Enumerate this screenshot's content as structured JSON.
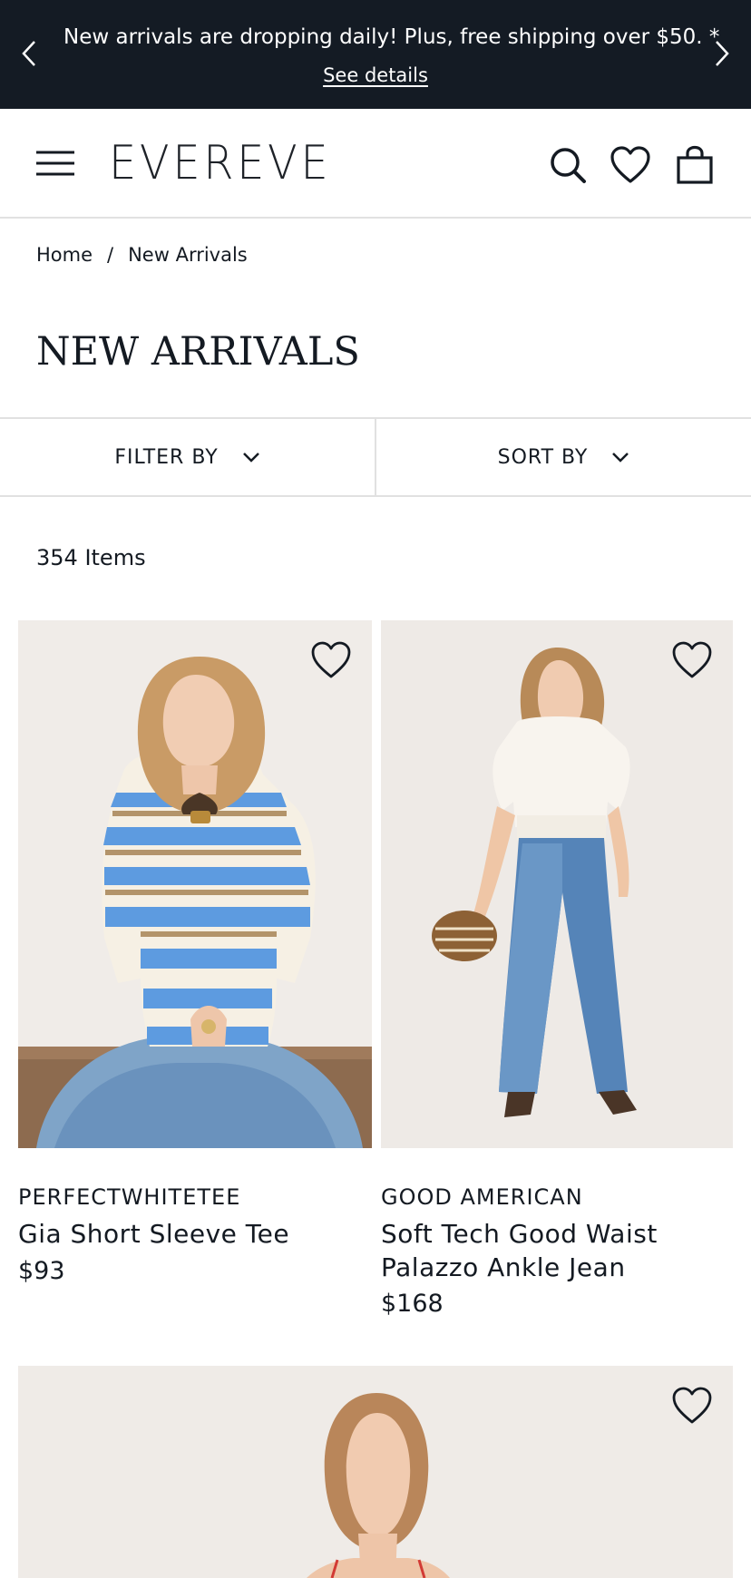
{
  "promo": {
    "message": "New arrivals are dropping daily! Plus, free shipping over $50. *",
    "details_link": "See details",
    "prev_icon": "chevron-left-icon",
    "next_icon": "chevron-right-icon",
    "background": "#141b24"
  },
  "header": {
    "logo": "EVEREVE",
    "menu_icon": "hamburger-menu-icon",
    "search_icon": "search-icon",
    "wishlist_icon": "heart-icon",
    "bag_icon": "shopping-bag-icon"
  },
  "breadcrumb": {
    "items": [
      "Home",
      "New Arrivals"
    ],
    "separator": "/"
  },
  "page_title": "NEW ARRIVALS",
  "toolbar": {
    "filter_label": "FILTER BY",
    "sort_label": "SORT BY"
  },
  "results": {
    "count_text": "354 Items"
  },
  "products": [
    {
      "brand": "PERFECTWHITETEE",
      "name": "Gia Short Sleeve Tee",
      "price": "$93"
    },
    {
      "brand": "GOOD AMERICAN",
      "name": "Soft Tech Good Waist Palazzo Ankle Jean",
      "price": "$168"
    },
    {
      "brand": "",
      "name": "",
      "price": ""
    }
  ]
}
